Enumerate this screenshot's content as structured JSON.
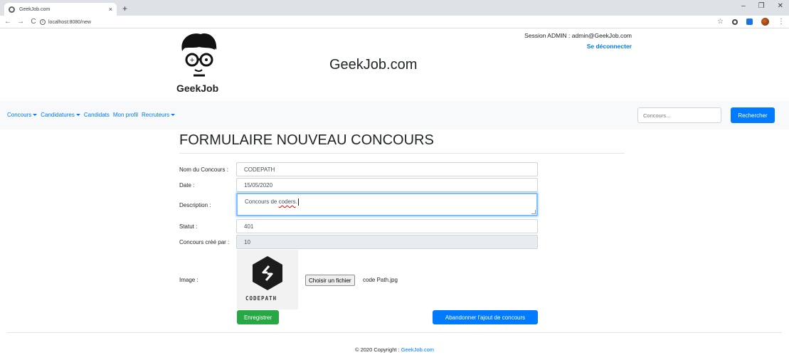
{
  "browser": {
    "tab_title": "GeekJob.com",
    "tab_close": "×",
    "new_tab": "+",
    "url": "localhost:8080/new",
    "icons": [
      "back-icon",
      "forward-icon",
      "reload-icon",
      "info-icon",
      "star-icon",
      "extension-icon",
      "profile-avatar"
    ]
  },
  "header": {
    "logo_text": "GeekJob",
    "brand_title": "GeekJob.com",
    "session_text": "Session ADMIN : admin@GeekJob.com",
    "logout_label": "Se déconnecter"
  },
  "navbar": {
    "items": [
      {
        "label": "Concours",
        "dropdown": true
      },
      {
        "label": "Candidatures",
        "dropdown": true
      },
      {
        "label": "Candidats",
        "dropdown": false
      },
      {
        "label": "Mon profil",
        "dropdown": false
      },
      {
        "label": "Recruteurs",
        "dropdown": true
      }
    ],
    "search_placeholder": "Concours...",
    "search_button": "Rechercher"
  },
  "form": {
    "heading": "FORMULAIRE NOUVEAU CONCOURS",
    "nom_label": "Nom du Concours :",
    "nom_value": "CODEPATH",
    "date_label": "Date :",
    "date_value": "15/05/2020",
    "description_label": "Description :",
    "description_prefix": "Concours de ",
    "description_misspelled": "coders",
    "description_suffix": ".",
    "statut_label": "Statut :",
    "statut_value": "401",
    "createur_label": "Concours créé par :",
    "createur_value": "10",
    "image_label": "Image :",
    "image_caption": "CODEPATH",
    "file_button": "Choisir un fichier",
    "file_name": "code Path.jpg",
    "save_button": "Enregistrer",
    "abandon_button": "Abandonner l'ajout de concours"
  },
  "footer": {
    "text": "© 2020 Copyright : ",
    "link": "GeekJob.com"
  },
  "colors": {
    "primary": "#007bff",
    "success": "#28a745",
    "navbar_bg": "#f8f9fa"
  }
}
